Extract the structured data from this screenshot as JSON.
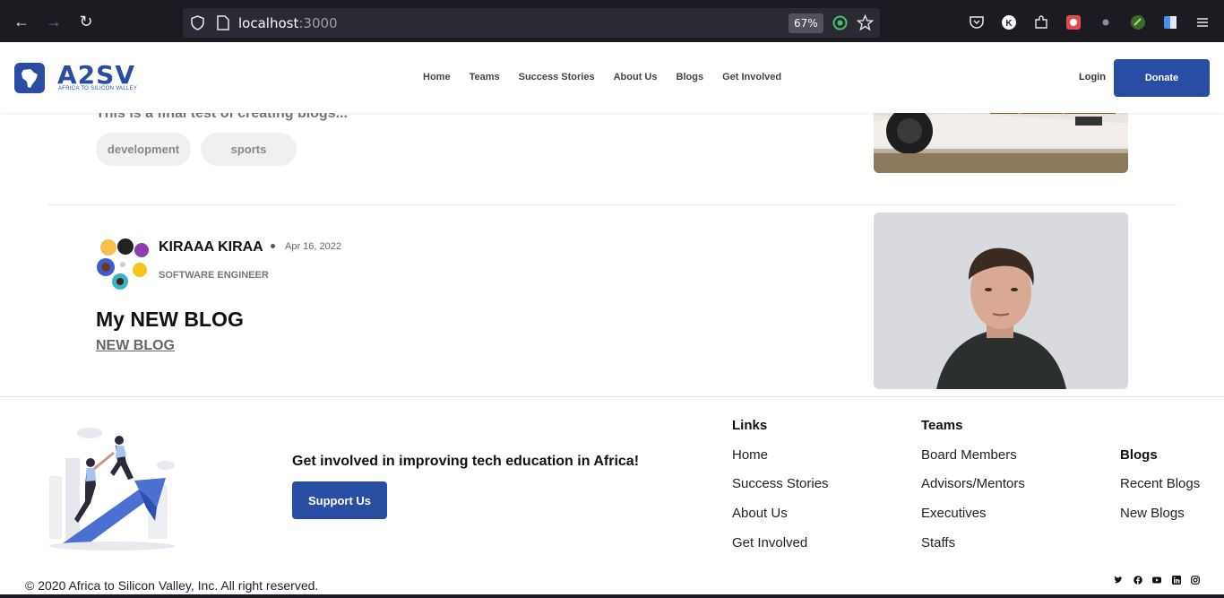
{
  "browser": {
    "url_host": "localhost",
    "url_port": ":3000",
    "zoom": "67%"
  },
  "header": {
    "logo_text": "A2SV",
    "logo_sub": "AFRICA TO SILICON VALLEY",
    "nav": [
      "Home",
      "Teams",
      "Success Stories",
      "About Us",
      "Blogs",
      "Get Involved"
    ],
    "login": "Login",
    "donate": "Donate"
  },
  "previous_post": {
    "excerpt": "This is a final test of creating blogs...",
    "tags": [
      "development",
      "sports"
    ]
  },
  "post": {
    "author": "KIRAAA KIRAA",
    "date": "Apr 16, 2022",
    "role": "SOFTWARE ENGINEER",
    "title": "My NEW BLOG",
    "excerpt": "NEW BLOG"
  },
  "footer": {
    "cta": "Get involved in improving tech education in Africa!",
    "support_button": "Support Us",
    "links_heading": "Links",
    "links": [
      "Home",
      "Success Stories",
      "About Us",
      "Get Involved"
    ],
    "teams_heading": "Teams",
    "teams": [
      "Board Members",
      "Advisors/Mentors",
      "Executives",
      "Staffs"
    ],
    "blogs_heading": "Blogs",
    "blogs": [
      "Recent Blogs",
      "New Blogs"
    ],
    "copyright": "© 2020 Africa to Silicon Valley, Inc. All right reserved.",
    "social_icons": [
      "twitter-icon",
      "facebook-icon",
      "youtube-icon",
      "linkedin-icon",
      "instagram-icon"
    ]
  },
  "colors": {
    "brand": "#2a4da4"
  }
}
